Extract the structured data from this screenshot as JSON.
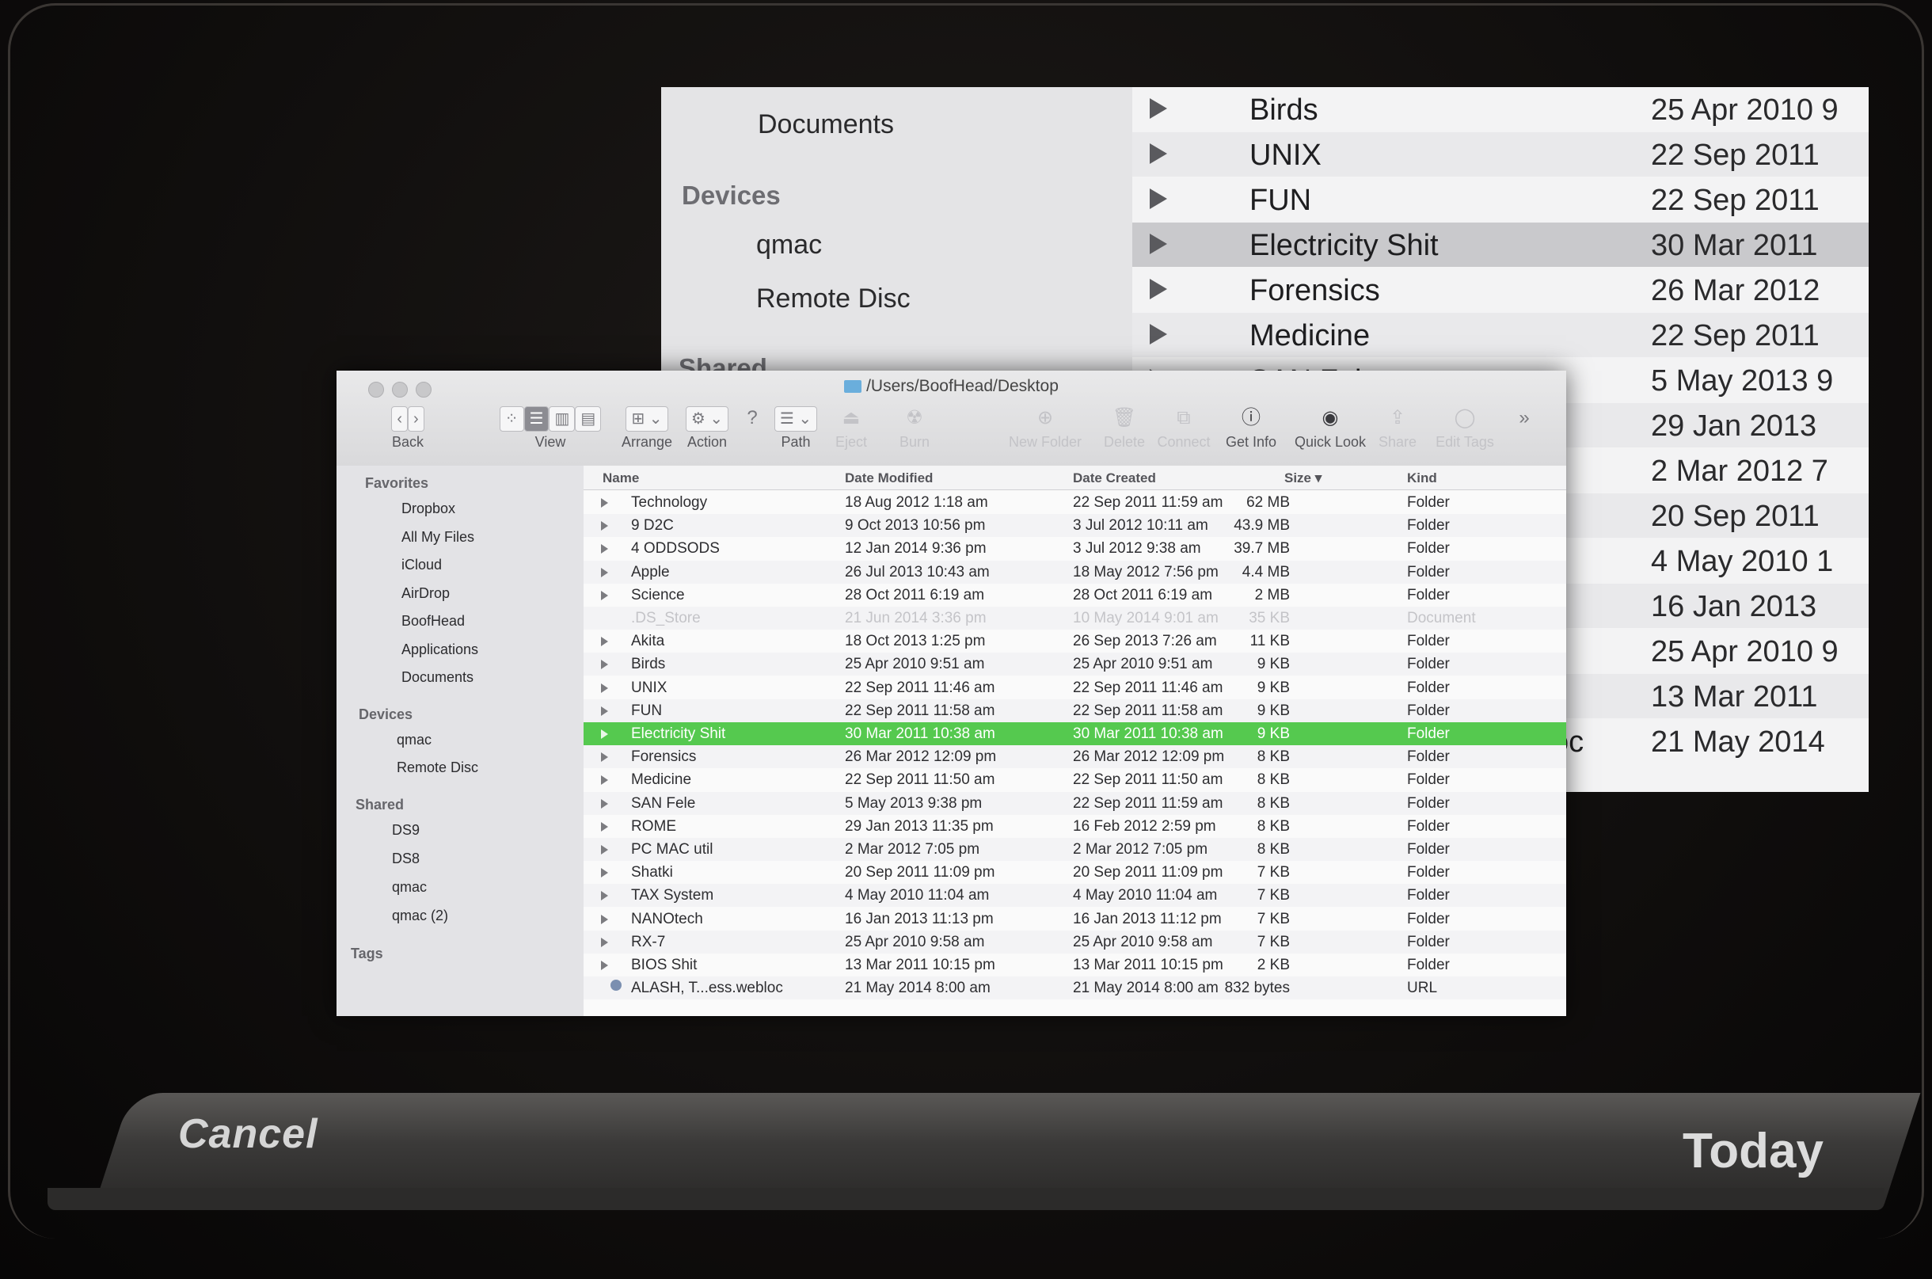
{
  "bg": {
    "sidebar": {
      "documents": "Documents",
      "devices_heading": "Devices",
      "qmac": "qmac",
      "remote_disc": "Remote Disc",
      "shared_heading": "Shared"
    },
    "rows": [
      {
        "name": "Birds",
        "date": "25 Apr 2010 9"
      },
      {
        "name": "UNIX",
        "date": "22 Sep 2011"
      },
      {
        "name": "FUN",
        "date": "22 Sep 2011"
      },
      {
        "name": "Electricity Shit",
        "date": "30 Mar 2011"
      },
      {
        "name": "Forensics",
        "date": "26 Mar 2012"
      },
      {
        "name": "Medicine",
        "date": "22 Sep 2011"
      },
      {
        "name": "SAN Fele",
        "date": "5 May 2013 9"
      },
      {
        "name": "",
        "date": "29 Jan 2013"
      },
      {
        "name": "",
        "date": "2 Mar 2012 7"
      },
      {
        "name": "",
        "date": "20 Sep 2011"
      },
      {
        "name": "",
        "date": "4 May 2010 1"
      },
      {
        "name": "",
        "date": "16 Jan 2013"
      },
      {
        "name": "",
        "date": "25 Apr 2010 9"
      },
      {
        "name": "",
        "date": "13 Mar 2011"
      },
      {
        "name": "oc",
        "date": "21 May 2014"
      }
    ]
  },
  "window": {
    "title": "/Users/BoofHead/Desktop",
    "toolbar": {
      "back": "Back",
      "view": "View",
      "arrange": "Arrange",
      "action": "Action",
      "path": "Path",
      "eject": "Eject",
      "burn": "Burn",
      "new_folder": "New Folder",
      "delete": "Delete",
      "connect": "Connect",
      "get_info": "Get Info",
      "quick_look": "Quick Look",
      "share": "Share",
      "edit_tags": "Edit Tags"
    },
    "sidebar": {
      "favorites_heading": "Favorites",
      "favorites": [
        "Dropbox",
        "All My Files",
        "iCloud",
        "AirDrop",
        "BoofHead",
        "Applications",
        "Documents"
      ],
      "devices_heading": "Devices",
      "devices": [
        "qmac",
        "Remote Disc"
      ],
      "shared_heading": "Shared",
      "shared": [
        "DS9",
        "DS8",
        "qmac",
        "qmac (2)"
      ],
      "tags_heading": "Tags"
    },
    "columns": {
      "name": "Name",
      "modified": "Date Modified",
      "created": "Date Created",
      "size": "Size ▾",
      "kind": "Kind"
    },
    "files": [
      {
        "name": "Technology",
        "modified": "18 Aug 2012 1:18 am",
        "created": "22 Sep 2011 11:59 am",
        "size": "62 MB",
        "kind": "Folder"
      },
      {
        "name": "9 D2C",
        "modified": "9 Oct 2013 10:56 pm",
        "created": "3 Jul 2012 10:11 am",
        "size": "43.9 MB",
        "kind": "Folder"
      },
      {
        "name": "4 ODDSODS",
        "modified": "12 Jan 2014 9:36 pm",
        "created": "3 Jul 2012 9:38 am",
        "size": "39.7 MB",
        "kind": "Folder"
      },
      {
        "name": "Apple",
        "modified": "26 Jul 2013 10:43 am",
        "created": "18 May 2012 7:56 pm",
        "size": "4.4 MB",
        "kind": "Folder"
      },
      {
        "name": "Science",
        "modified": "28 Oct 2011 6:19 am",
        "created": "28 Oct 2011 6:19 am",
        "size": "2 MB",
        "kind": "Folder"
      },
      {
        "name": ".DS_Store",
        "modified": "21 Jun 2014 3:36 pm",
        "created": "10 May 2014 9:01 am",
        "size": "35 KB",
        "kind": "Document"
      },
      {
        "name": "Akita",
        "modified": "18 Oct 2013 1:25 pm",
        "created": "26 Sep 2013 7:26 am",
        "size": "11 KB",
        "kind": "Folder"
      },
      {
        "name": "Birds",
        "modified": "25 Apr 2010 9:51 am",
        "created": "25 Apr 2010 9:51 am",
        "size": "9 KB",
        "kind": "Folder"
      },
      {
        "name": "UNIX",
        "modified": "22 Sep 2011 11:46 am",
        "created": "22 Sep 2011 11:46 am",
        "size": "9 KB",
        "kind": "Folder"
      },
      {
        "name": "FUN",
        "modified": "22 Sep 2011 11:58 am",
        "created": "22 Sep 2011 11:58 am",
        "size": "9 KB",
        "kind": "Folder"
      },
      {
        "name": "Electricity Shit",
        "modified": "30 Mar 2011 10:38 am",
        "created": "30 Mar 2011 10:38 am",
        "size": "9 KB",
        "kind": "Folder"
      },
      {
        "name": "Forensics",
        "modified": "26 Mar 2012 12:09 pm",
        "created": "26 Mar 2012 12:09 pm",
        "size": "8 KB",
        "kind": "Folder"
      },
      {
        "name": "Medicine",
        "modified": "22 Sep 2011 11:50 am",
        "created": "22 Sep 2011 11:50 am",
        "size": "8 KB",
        "kind": "Folder"
      },
      {
        "name": "SAN Fele",
        "modified": "5 May 2013 9:38 pm",
        "created": "22 Sep 2011 11:59 am",
        "size": "8 KB",
        "kind": "Folder"
      },
      {
        "name": "ROME",
        "modified": "29 Jan 2013 11:35 pm",
        "created": "16 Feb 2012 2:59 pm",
        "size": "8 KB",
        "kind": "Folder"
      },
      {
        "name": "PC MAC util",
        "modified": "2 Mar 2012 7:05 pm",
        "created": "2 Mar 2012 7:05 pm",
        "size": "8 KB",
        "kind": "Folder"
      },
      {
        "name": "Shatki",
        "modified": "20 Sep 2011 11:09 pm",
        "created": "20 Sep 2011 11:09 pm",
        "size": "7 KB",
        "kind": "Folder"
      },
      {
        "name": "TAX System",
        "modified": "4 May 2010 11:04 am",
        "created": "4 May 2010 11:04 am",
        "size": "7 KB",
        "kind": "Folder"
      },
      {
        "name": "NANOtech",
        "modified": "16 Jan 2013 11:13 pm",
        "created": "16 Jan 2013 11:12 pm",
        "size": "7 KB",
        "kind": "Folder"
      },
      {
        "name": "RX-7",
        "modified": "25 Apr 2010 9:58 am",
        "created": "25 Apr 2010 9:58 am",
        "size": "7 KB",
        "kind": "Folder"
      },
      {
        "name": "BIOS Shit",
        "modified": "13 Mar 2011 10:15 pm",
        "created": "13 Mar 2011 10:15 pm",
        "size": "2 KB",
        "kind": "Folder"
      },
      {
        "name": "ALASH, T...ess.webloc",
        "modified": "21 May 2014 8:00 am",
        "created": "21 May 2014 8:00 am",
        "size": "832 bytes",
        "kind": "URL"
      }
    ],
    "selected_file": "Electricity Shit"
  },
  "bottombar": {
    "cancel": "Cancel",
    "today": "Today"
  }
}
